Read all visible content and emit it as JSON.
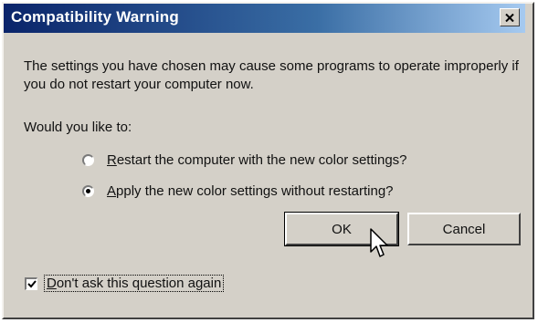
{
  "window": {
    "title": "Compatibility Warning"
  },
  "message": {
    "body": "The settings you have chosen may cause some programs to operate improperly if you do not restart your computer now.",
    "question": "Would you like to:"
  },
  "options": [
    {
      "label": "Restart the computer with the new color settings?",
      "selected": false
    },
    {
      "label": "Apply the new color settings without restarting?",
      "selected": true
    }
  ],
  "buttons": {
    "ok_label": "OK",
    "cancel_label": "Cancel"
  },
  "checkbox": {
    "label": "Don't ask this question again",
    "checked": true
  },
  "icons": {
    "close": "close-icon",
    "cursor": "mouse-pointer-icon"
  },
  "colors": {
    "titlebar_start": "#0a246a",
    "titlebar_end": "#a6caf0",
    "dialog_face": "#d4d0c8"
  }
}
